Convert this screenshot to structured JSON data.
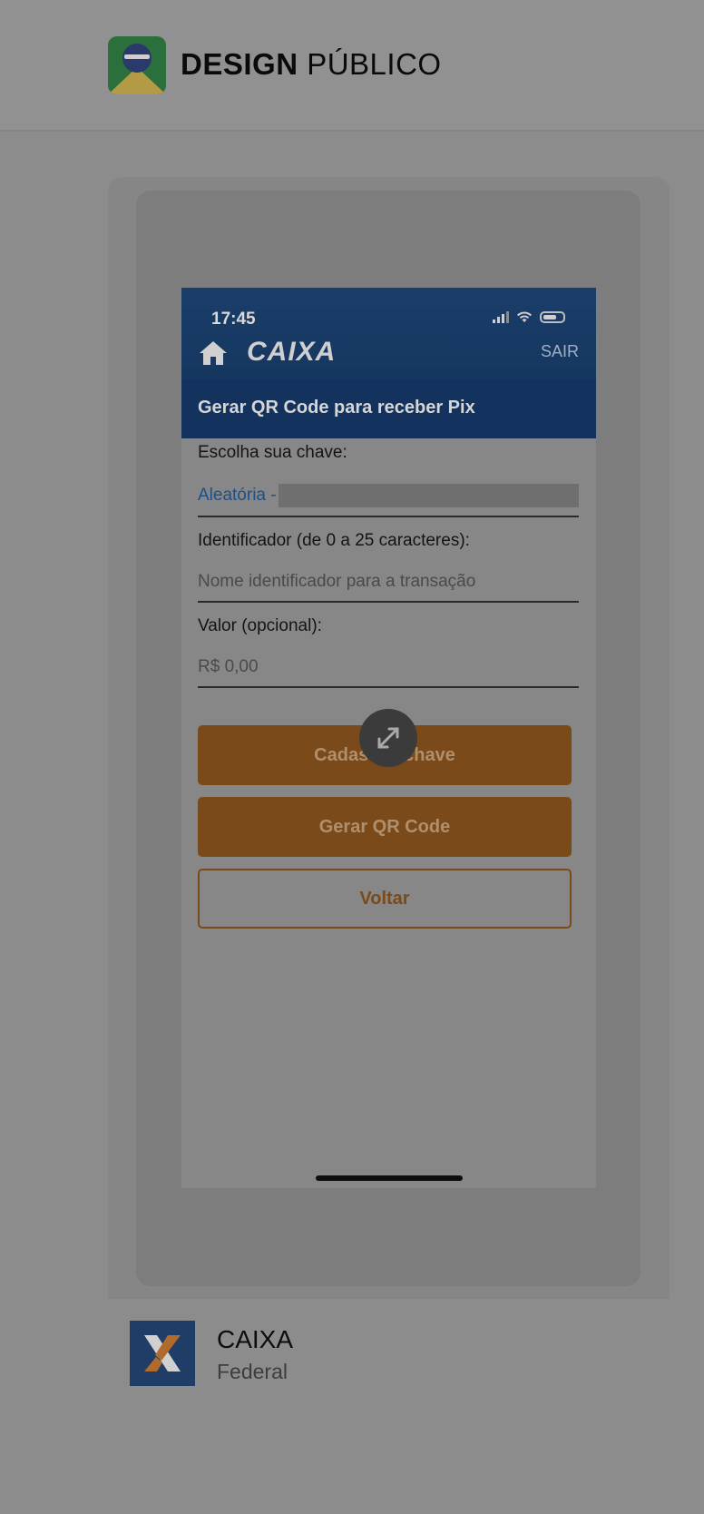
{
  "site": {
    "brand_bold": "DESIGN",
    "brand_light": "PÚBLICO"
  },
  "phone": {
    "status_time": "17:45",
    "header": {
      "logo_text": "CAIXA",
      "logout_label": "SAIR"
    },
    "page_title": "Gerar QR Code para receber Pix",
    "key_label": "Escolha sua chave:",
    "key_value": "Aleatória -",
    "identifier_label": "Identificador (de 0 a 25 caracteres):",
    "identifier_placeholder": "Nome identificador para a transação",
    "value_label": "Valor (opcional):",
    "value_placeholder": "R$ 0,00",
    "buttons": {
      "register_key": "Cadastrar chave",
      "generate_qr": "Gerar QR Code",
      "back": "Voltar"
    }
  },
  "app": {
    "name": "CAIXA",
    "category": "Federal"
  },
  "colors": {
    "brand_orange": "#7a4a1b",
    "header_blue": "#13325d",
    "link_blue": "#1d4f88"
  },
  "icons": [
    "home-icon",
    "signal-icon",
    "wifi-icon",
    "battery-icon",
    "expand-icon",
    "caixa-x-icon"
  ]
}
